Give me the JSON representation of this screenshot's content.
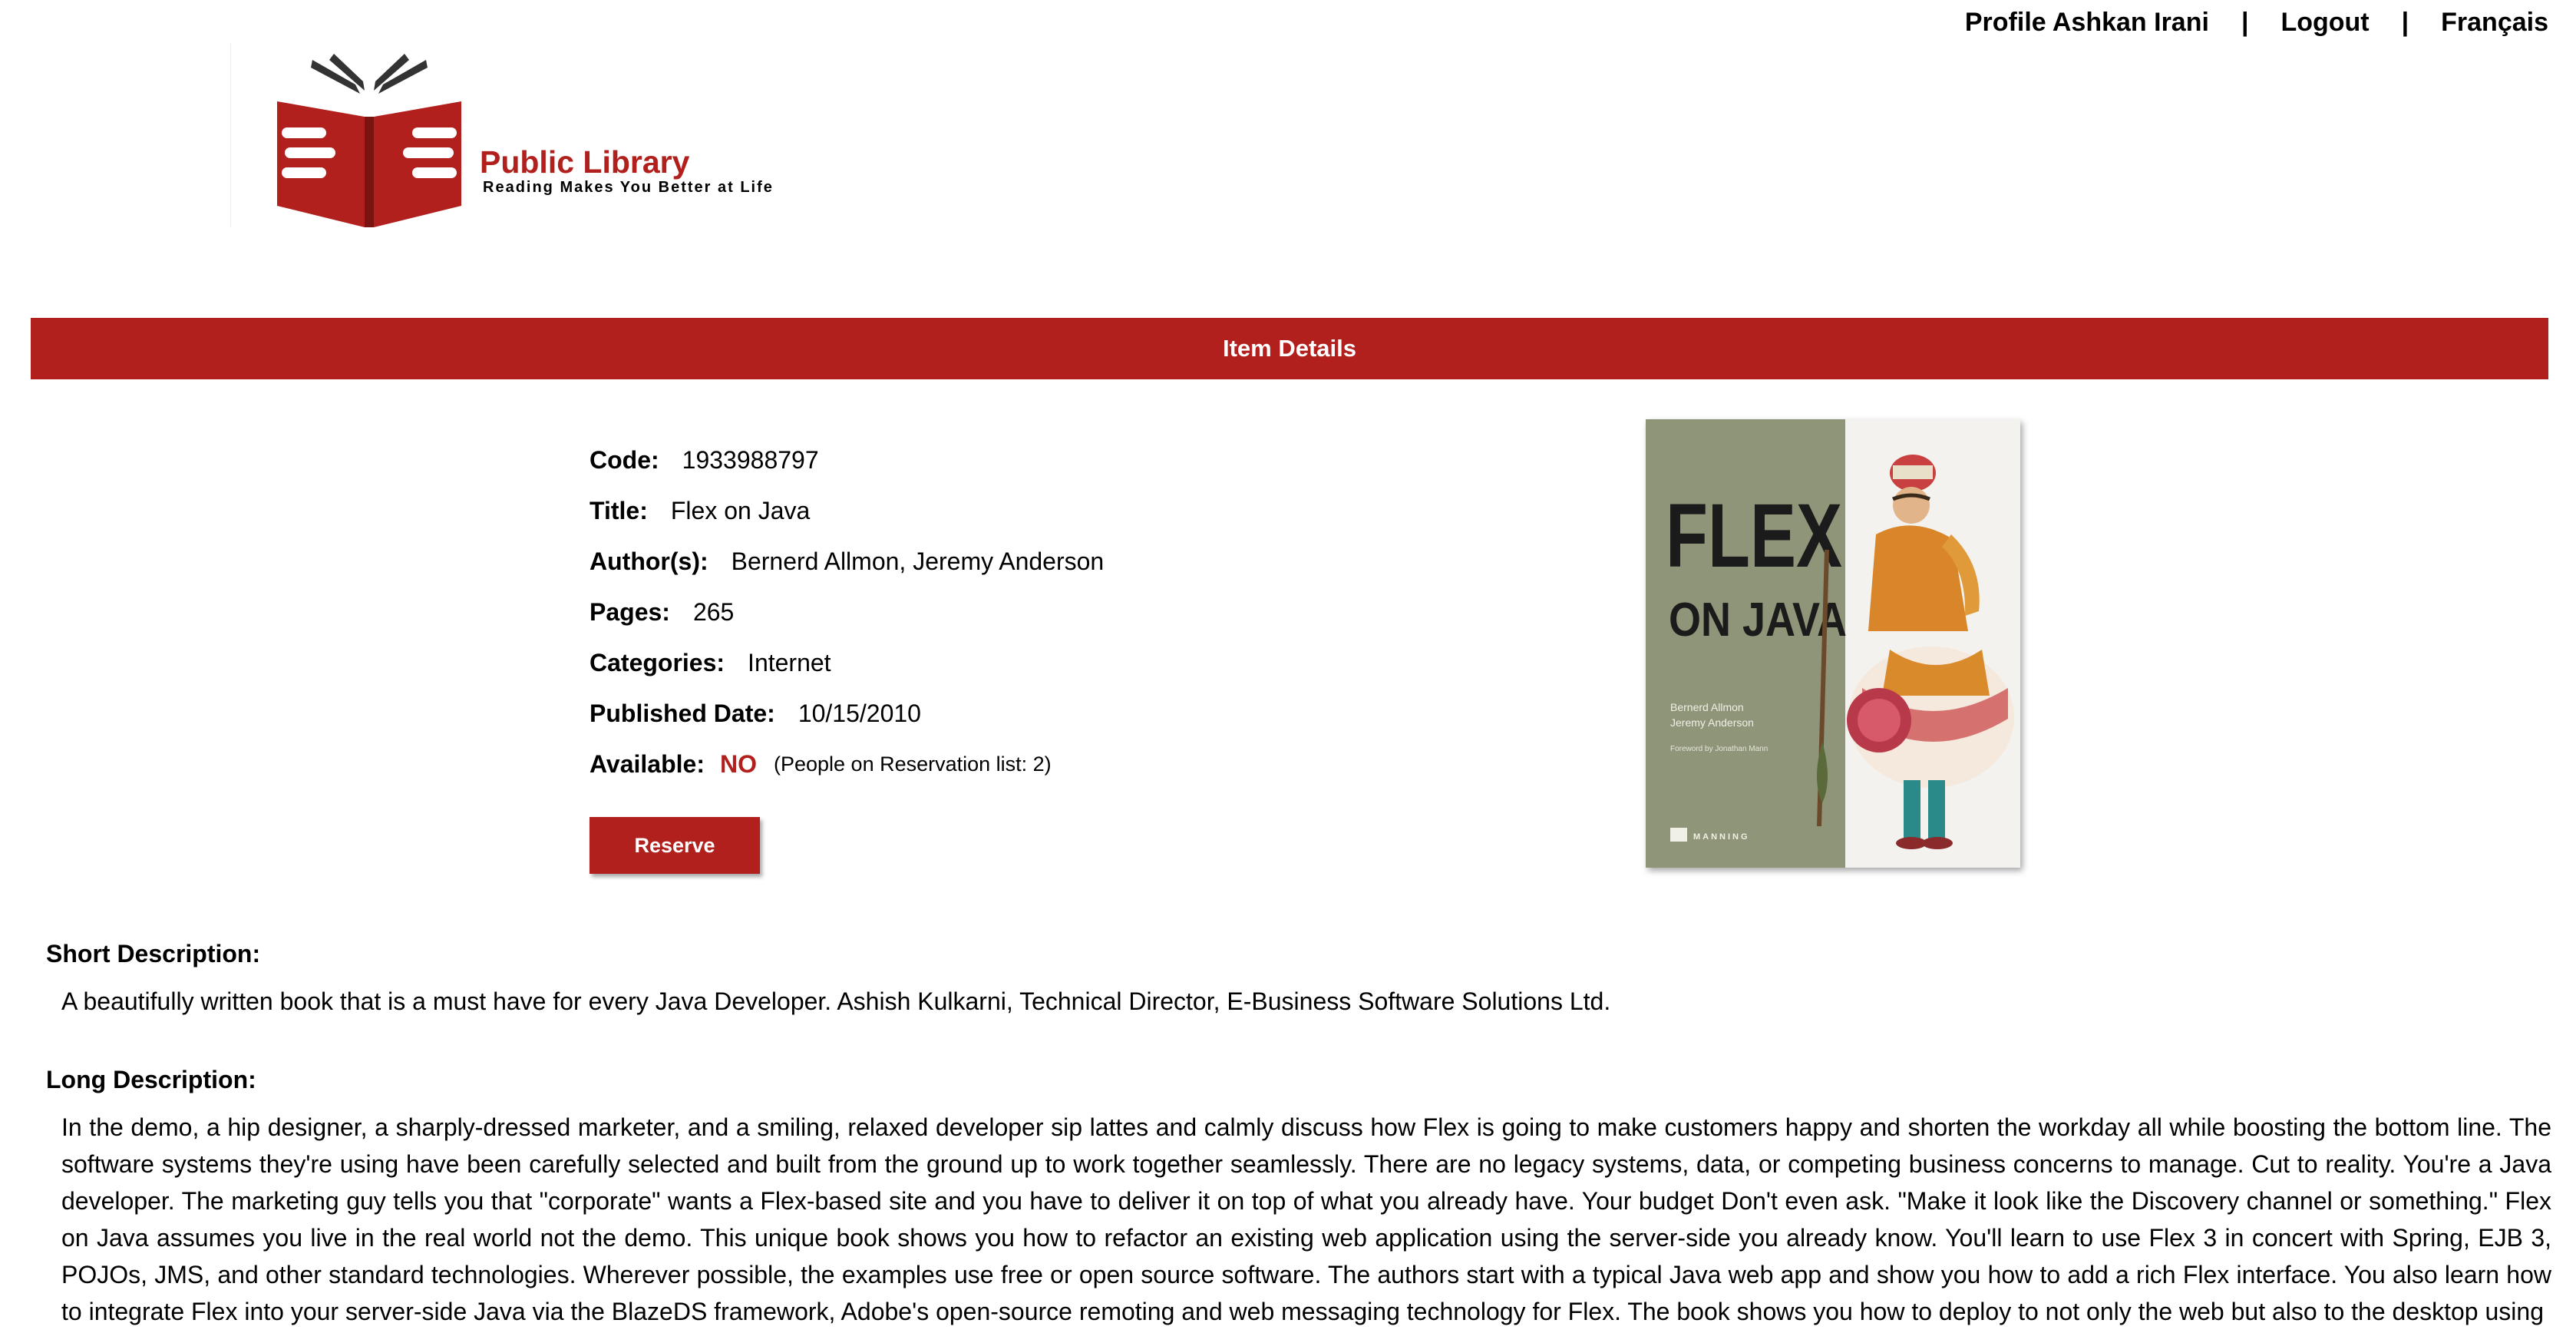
{
  "nav": {
    "profile": "Profile Ashkan Irani",
    "separator": "|",
    "logout": "Logout",
    "language": "Français"
  },
  "logo": {
    "title": "Public Library",
    "tagline": "Reading Makes You Better at Life"
  },
  "banner": {
    "title": "Item Details"
  },
  "details": {
    "code_label": "Code:",
    "code": "1933988797",
    "title_label": "Title:",
    "title": "Flex on Java",
    "authors_label": "Author(s):",
    "authors": "Bernerd Allmon, Jeremy Anderson",
    "pages_label": "Pages:",
    "pages": "265",
    "categories_label": "Categories:",
    "categories": "Internet",
    "published_label": "Published Date:",
    "published": "10/15/2010",
    "available_label": "Available:",
    "available": "NO",
    "reservation_note": "(People on Reservation list: 2)",
    "reserve_button": "Reserve"
  },
  "cover": {
    "title_line1": "FLEX",
    "title_line2": "ON JAVA",
    "author1": "Bernerd Allmon",
    "author2": "Jeremy Anderson",
    "foreword": "Foreword by Jonathan Mann",
    "publisher": "MANNING"
  },
  "short_description": {
    "label": "Short Description:",
    "text": "A beautifully written book that is a must have for every Java Developer. Ashish Kulkarni, Technical Director, E-Business Software Solutions Ltd."
  },
  "long_description": {
    "label": "Long Description:",
    "text": "In the demo, a hip designer, a sharply-dressed marketer, and a smiling, relaxed developer sip lattes and calmly discuss how Flex is going to make customers happy and shorten the workday all while boosting the bottom line. The software systems they're using have been carefully selected and built from the ground up to work together seamlessly. There are no legacy systems, data, or competing business concerns to manage. Cut to reality. You're a Java developer. The marketing guy tells you that \"corporate\" wants a Flex-based site and you have to deliver it on top of what you already have. Your budget Don't even ask. \"Make it look like the Discovery channel or something.\" Flex on Java assumes you live in the real world not the demo. This unique book shows you how to refactor an existing web application using the server-side you already know. You'll learn to use Flex 3 in concert with Spring, EJB 3, POJOs, JMS, and other standard technologies. Wherever possible, the examples use free or open source software. The authors start with a typical Java web app and show you how to add a rich Flex interface. You also learn how to integrate Flex into your server-side Java via the BlazeDS framework, Adobe's open-source remoting and web messaging technology for Flex. The book shows you how to deploy to not only the web but also to the desktop using"
  },
  "colors": {
    "brand": "#b2201d",
    "cover_left": "#8f9579"
  }
}
